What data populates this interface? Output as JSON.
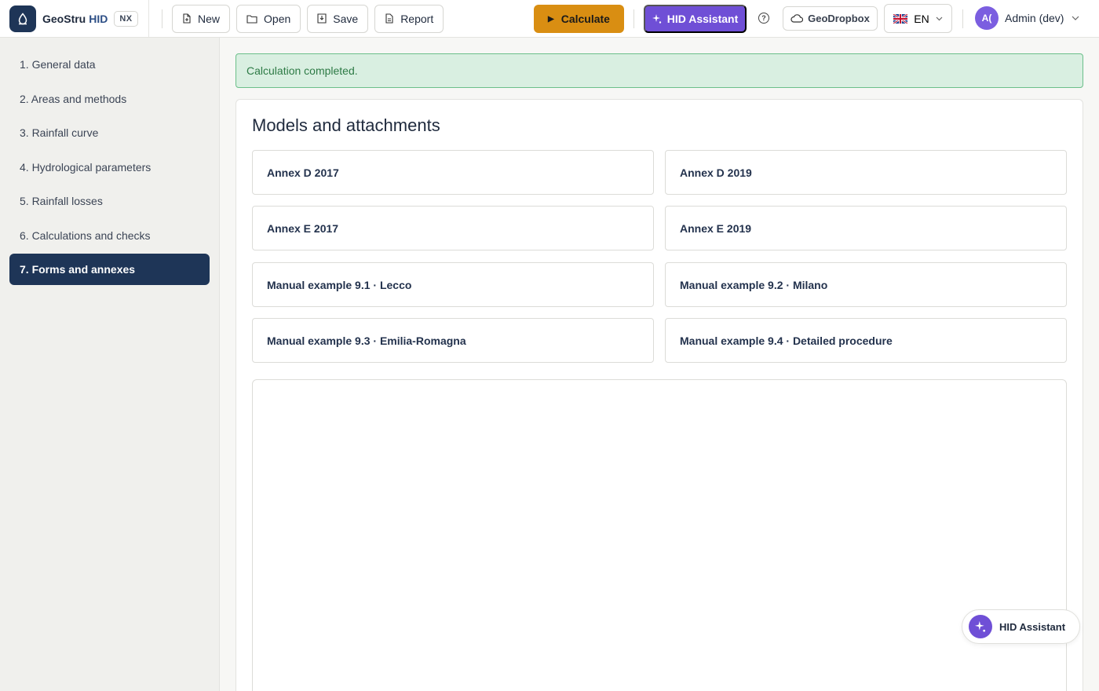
{
  "brand": {
    "name": "GeoStru",
    "product": "HID",
    "badge": "NX"
  },
  "toolbar": {
    "new_label": "New",
    "open_label": "Open",
    "save_label": "Save",
    "report_label": "Report",
    "calculate_label": "Calculate",
    "assistant_label": "HID Assistant",
    "dropbox_label": "GeoDropbox",
    "language": "EN",
    "user_initials": "A(",
    "user_name": "Admin (dev)"
  },
  "sidebar": {
    "items": [
      {
        "label": "1. General data"
      },
      {
        "label": "2. Areas and methods"
      },
      {
        "label": "3. Rainfall curve"
      },
      {
        "label": "4. Hydrological parameters"
      },
      {
        "label": "5. Rainfall losses"
      },
      {
        "label": "6. Calculations and checks"
      },
      {
        "label": "7. Forms and annexes",
        "active": true
      }
    ]
  },
  "alert": {
    "message": "Calculation completed."
  },
  "main": {
    "title": "Models and attachments",
    "cards": [
      {
        "label": "Annex D 2017"
      },
      {
        "label": "Annex D 2019"
      },
      {
        "label": "Annex E 2017"
      },
      {
        "label": "Annex E 2019"
      },
      {
        "label": "Manual example 9.1 · Lecco"
      },
      {
        "label": "Manual example 9.2 · Milano"
      },
      {
        "label": "Manual example 9.3 · Emilia-Romagna"
      },
      {
        "label": "Manual example 9.4 · Detailed procedure"
      }
    ]
  },
  "floating_assistant": {
    "label": "HID Assistant"
  },
  "colors": {
    "brand_navy": "#1e3557",
    "calculate": "#d98e12",
    "assistant": "#6f4fd6",
    "success_bg": "#d9efe1",
    "success_text": "#2d7a45"
  }
}
